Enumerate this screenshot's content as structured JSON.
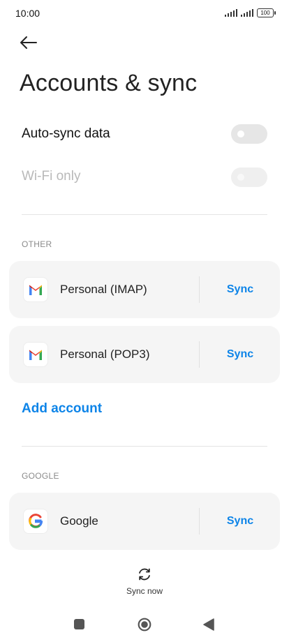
{
  "status_bar": {
    "time": "10:00",
    "battery": "100",
    "icons": [
      "signal-icon",
      "signal-icon",
      "battery-icon"
    ]
  },
  "header": {
    "back_icon": "arrow-left-icon",
    "title": "Accounts & sync"
  },
  "settings": {
    "auto_sync": {
      "label": "Auto-sync data",
      "enabled": false
    },
    "wifi_only": {
      "label": "Wi-Fi only",
      "enabled": false,
      "disabled": true
    }
  },
  "sections": {
    "other": {
      "header": "OTHER",
      "accounts": [
        {
          "name": "Personal (IMAP)",
          "icon": "gmail-icon",
          "action": "Sync"
        },
        {
          "name": "Personal (POP3)",
          "icon": "gmail-icon",
          "action": "Sync"
        }
      ]
    },
    "add_account": "Add account",
    "google": {
      "header": "GOOGLE",
      "accounts": [
        {
          "name": "Google",
          "icon": "google-icon",
          "action": "Sync"
        }
      ]
    }
  },
  "footer": {
    "sync_now": "Sync now",
    "sync_icon": "sync-icon"
  },
  "nav_bar": {
    "icons": [
      "recents-icon",
      "home-icon",
      "back-icon"
    ]
  },
  "colors": {
    "accent": "#0d84e8",
    "card_bg": "#f5f5f5",
    "toggle_off": "#e6e6e6",
    "disabled_text": "#b9b9b9"
  }
}
